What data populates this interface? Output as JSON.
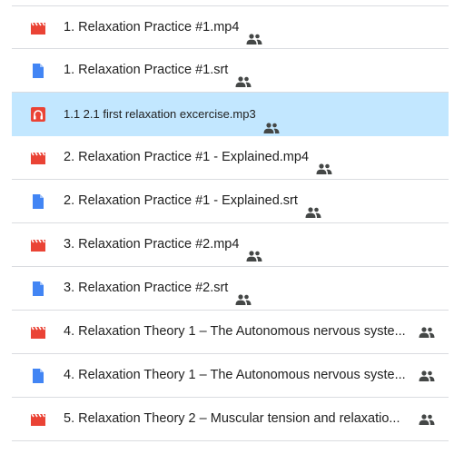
{
  "files": [
    {
      "name": "1. Relaxation Practice #1.mp4",
      "type": "video",
      "icon": "video-file-icon",
      "shared": true,
      "selected": false
    },
    {
      "name": "1. Relaxation Practice #1.srt",
      "type": "doc",
      "icon": "document-file-icon",
      "shared": true,
      "selected": false
    },
    {
      "name": "1.1 2.1 first relaxation excercise.mp3",
      "type": "audio",
      "icon": "audio-file-icon",
      "shared": true,
      "selected": true
    },
    {
      "name": "2. Relaxation Practice #1 - Explained.mp4",
      "type": "video",
      "icon": "video-file-icon",
      "shared": true,
      "selected": false
    },
    {
      "name": "2. Relaxation Practice #1 - Explained.srt",
      "type": "doc",
      "icon": "document-file-icon",
      "shared": true,
      "selected": false
    },
    {
      "name": "3. Relaxation Practice #2.mp4",
      "type": "video",
      "icon": "video-file-icon",
      "shared": true,
      "selected": false
    },
    {
      "name": "3. Relaxation Practice #2.srt",
      "type": "doc",
      "icon": "document-file-icon",
      "shared": true,
      "selected": false
    },
    {
      "name": "4. Relaxation Theory 1 – The Autonomous nervous syste...",
      "type": "video",
      "icon": "video-file-icon",
      "shared": true,
      "selected": false
    },
    {
      "name": "4. Relaxation Theory 1 – The Autonomous nervous syste...",
      "type": "doc",
      "icon": "document-file-icon",
      "shared": true,
      "selected": false
    },
    {
      "name": "5. Relaxation Theory 2 – Muscular tension and relaxatio...",
      "type": "video",
      "icon": "video-file-icon",
      "shared": true,
      "selected": false
    }
  ],
  "colors": {
    "video": "#ea4335",
    "doc": "#4285f4",
    "audio": "#ea4335",
    "selected_bg": "#c2e7ff",
    "divider": "#dadce0",
    "text": "#1f1f1f",
    "shared_icon": "#444746"
  }
}
